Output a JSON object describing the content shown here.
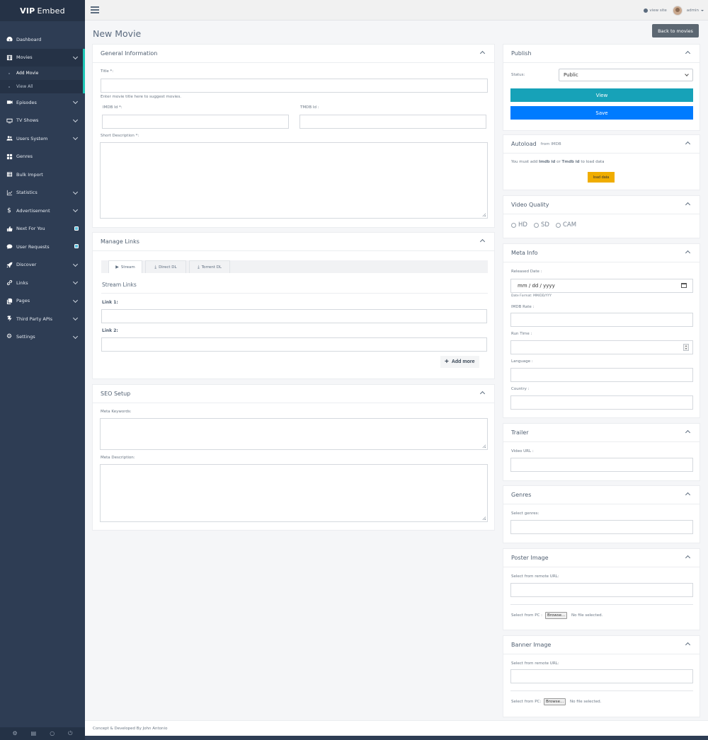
{
  "brand": {
    "bold": "VIP",
    "rest": "Embed"
  },
  "sidebar": {
    "items": [
      {
        "label": "Dashboard",
        "icon": "dashboard-icon"
      },
      {
        "label": "Movies",
        "icon": "film-icon"
      },
      {
        "label": "Episodes",
        "icon": "video-icon"
      },
      {
        "label": "TV Shows",
        "icon": "tv-icon"
      },
      {
        "label": "Users System",
        "icon": "users-icon"
      },
      {
        "label": "Genres",
        "icon": "grid-icon"
      },
      {
        "label": "Bulk Import",
        "icon": "list-icon"
      },
      {
        "label": "Statistics",
        "icon": "chart-icon"
      },
      {
        "label": "Advertisement",
        "icon": "dollar-icon"
      },
      {
        "label": "Next For You",
        "icon": "thumbs-up-icon"
      },
      {
        "label": "User Requests",
        "icon": "comments-icon"
      },
      {
        "label": "Discover",
        "icon": "rocket-icon"
      },
      {
        "label": "Links",
        "icon": "link-icon"
      },
      {
        "label": "Pages",
        "icon": "copy-icon"
      },
      {
        "label": "Third Party APIs",
        "icon": "bolt-icon"
      },
      {
        "label": "Settings",
        "icon": "gear-icon"
      }
    ],
    "movies_sub": {
      "add": "Add Movie",
      "view": "View All"
    }
  },
  "topbar": {
    "view_site": "view site",
    "user": "admin"
  },
  "page": {
    "title": "New Movie",
    "back": "Back to movies"
  },
  "general": {
    "title": "General Information",
    "title_label": "Title *:",
    "title_hint": "Enter movie title here to suggest movies.",
    "imdb_label": "IMDB Id *:",
    "tmdb_label": "TMDB Id :",
    "desc_label": "Short Description *:"
  },
  "links": {
    "title": "Manage Links",
    "tabs": [
      "Stream",
      "Direct DL",
      "Torrent DL"
    ],
    "section": "Stream Links",
    "link1": "Link 1:",
    "link2": "Link 2:",
    "add_more": "Add more"
  },
  "seo": {
    "title": "SEO Setup",
    "keywords": "Meta Keywords:",
    "description": "Meta Description:"
  },
  "publish": {
    "title": "Publish",
    "status_label": "Status:",
    "status_value": "Public",
    "view": "View",
    "save": "Save"
  },
  "autoload": {
    "title": "Autoload",
    "from": "from IMDB",
    "msg_pre": "You must add",
    "imdb": "Imdb id",
    "or": "or",
    "tmdb": "Tmdb id",
    "msg_post": "to load data",
    "button": "load data"
  },
  "quality": {
    "title": "Video Quality",
    "options": [
      "HD",
      "SD",
      "CAM"
    ]
  },
  "meta": {
    "title": "Meta Info",
    "released": "Released Date :",
    "date_placeholder": "mm / dd / yyyy",
    "date_format": "Date Format: MM/DD/YYY",
    "rate": "IMDB Rate :",
    "runtime": "Run Time :",
    "language": "Language :",
    "country": "Country :"
  },
  "trailer": {
    "title": "Trailer",
    "label": "Video URL :"
  },
  "genres": {
    "title": "Genres",
    "label": "Select genres:"
  },
  "poster": {
    "title": "Poster Image",
    "remote": "Select from remote URL:",
    "pc": "Select from PC :",
    "browse": "Browse...",
    "nofile": "No file selected."
  },
  "banner": {
    "title": "Banner Image",
    "remote": "Select from remote URL:",
    "pc": "Select from PC:",
    "browse": "Browse...",
    "nofile": "No file selected."
  },
  "footer": {
    "text": "Concept & Developed By John Antonio"
  },
  "colors": {
    "sidebar": "#2e3d54",
    "view_button": "#17a2b8",
    "save_button": "#007bff",
    "load_button": "#f0ad00",
    "accent_bar": "#1ec7b7"
  }
}
